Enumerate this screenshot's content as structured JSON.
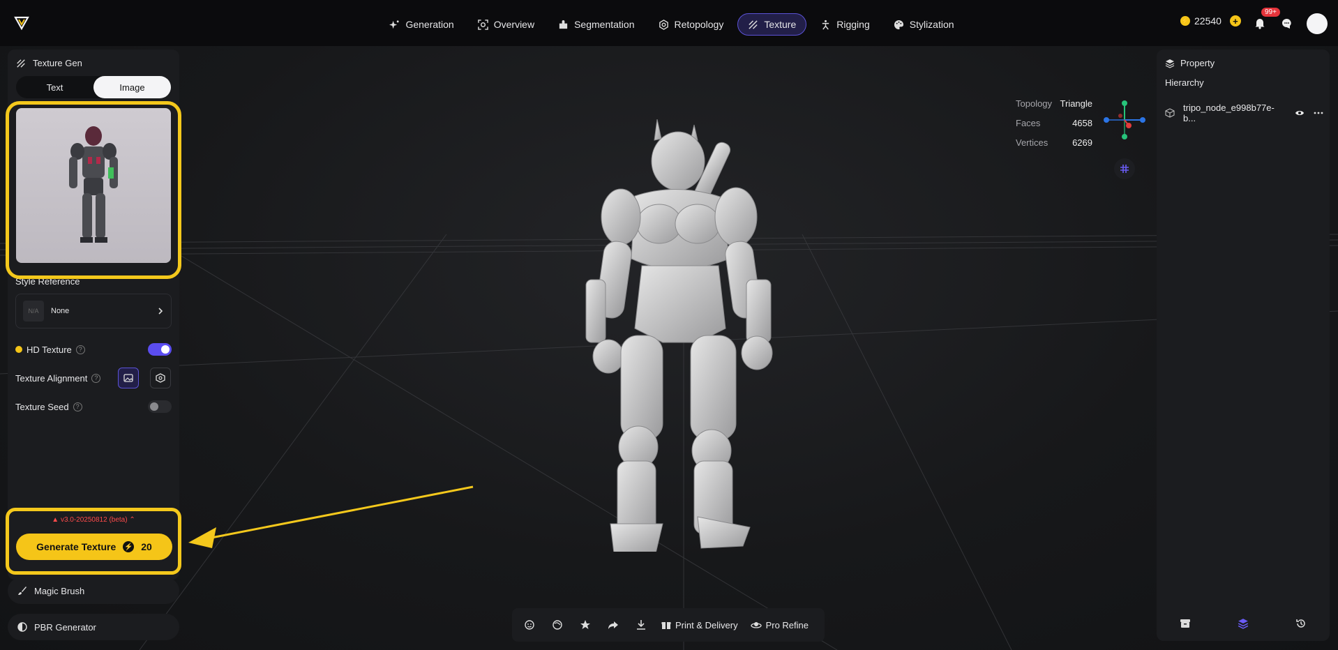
{
  "nav": {
    "items": [
      {
        "label": "Generation",
        "icon": "sparkle-icon"
      },
      {
        "label": "Overview",
        "icon": "scan-icon"
      },
      {
        "label": "Segmentation",
        "icon": "puzzle-icon"
      },
      {
        "label": "Retopology",
        "icon": "gear-icon"
      },
      {
        "label": "Texture",
        "icon": "texture-icon",
        "active": true
      },
      {
        "label": "Rigging",
        "icon": "figure-icon"
      },
      {
        "label": "Stylization",
        "icon": "palette-icon"
      }
    ]
  },
  "header": {
    "credits": "22540",
    "notifications": "99+"
  },
  "left_panel": {
    "title": "Texture Gen",
    "tabs": [
      "Text",
      "Image"
    ],
    "active_tab": "Image",
    "style_reference_label": "Style Reference",
    "style_reference_na": "N/A",
    "style_reference_value": "None",
    "hd_texture_label": "HD Texture",
    "hd_texture_on": true,
    "texture_alignment_label": "Texture Alignment",
    "texture_seed_label": "Texture Seed",
    "texture_seed_on": false,
    "version": "v3.0-20250812 (beta)",
    "generate_label": "Generate Texture",
    "generate_cost": "20",
    "magic_brush_label": "Magic Brush",
    "pbr_label": "PBR Generator"
  },
  "stats": {
    "topology_label": "Topology",
    "topology_value": "Triangle",
    "faces_label": "Faces",
    "faces_value": "4658",
    "vertices_label": "Vertices",
    "vertices_value": "6269"
  },
  "right_panel": {
    "title": "Property",
    "hierarchy_label": "Hierarchy",
    "node_name": "tripo_node_e998b77e-b..."
  },
  "toolbar": {
    "print_label": "Print & Delivery",
    "refine_label": "Pro Refine"
  },
  "colors": {
    "accent": "#5b4df0",
    "highlight": "#f4c81c",
    "generate": "#f5c518"
  }
}
